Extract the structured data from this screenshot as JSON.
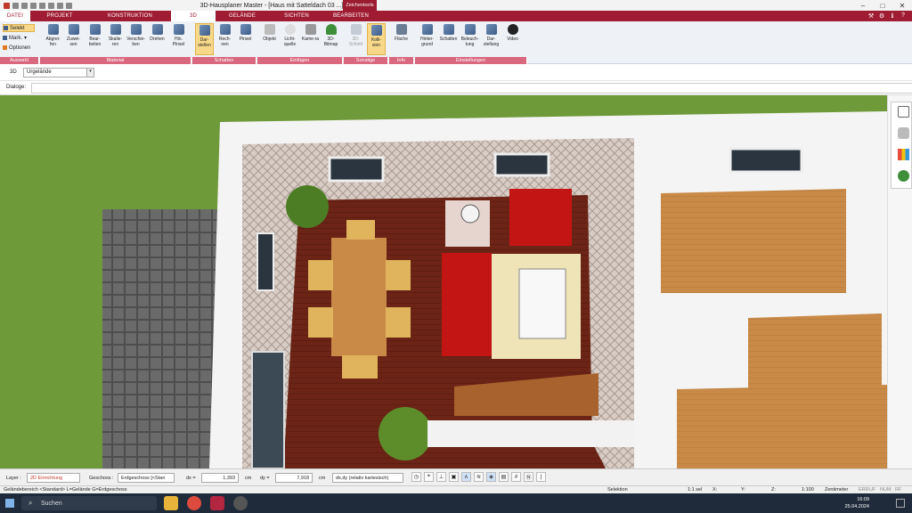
{
  "window": {
    "title": "3D-Hausplaner Master - [Haus mit Satteldach 03 ...]",
    "context_tab": "Zeichentools"
  },
  "tabs": {
    "file": "DATEI",
    "items": [
      "PROJEKT",
      "KONSTRUKTION",
      "3D",
      "GELÄNDE",
      "SICHTEN",
      "BEARBEITEN"
    ],
    "active": "3D"
  },
  "ribbon": {
    "auswahl": {
      "select": "Selekt",
      "mark": "Mark.",
      "options": "Optionen",
      "label": "Auswahl"
    },
    "material": {
      "label": "Material",
      "buttons": [
        "Abgrei-fen",
        "Zuwei-sen",
        "Bear-beiten",
        "Skalie-ren",
        "Verschie-ben",
        "Drehen",
        "Hin. Pinsel"
      ]
    },
    "schatten": {
      "label": "Schatten",
      "buttons": [
        "Dar-stellen",
        "Rech-nen",
        "Pinsel"
      ]
    },
    "einfuegen": {
      "label": "Einfügen",
      "buttons": [
        "Objekt",
        "Licht-quelle",
        "Kame-ra",
        "3D-Bitmap"
      ]
    },
    "sonstige": {
      "label": "Sonstige",
      "buttons": [
        "3D-Schnitt",
        "Kolli-sion"
      ]
    },
    "info": {
      "label": "Info",
      "buttons": [
        "Fläche"
      ]
    },
    "einstellungen": {
      "label": "Einstellungen",
      "buttons": [
        "Hinter-grund",
        "Schatten",
        "Beleuch-tung",
        "Dar-stellung",
        "Video"
      ]
    }
  },
  "optbar": {
    "mode": "3D",
    "combo_value": "Urgelände"
  },
  "dialog": {
    "label": "Dialoge:"
  },
  "statusbar": {
    "layer_label": "Layer :",
    "layer_value": "2D Einrichtung",
    "geschoss_label": "Geschoss :",
    "geschoss_value": "Erdgeschoss [<Stan",
    "dx_label": "dx =",
    "dx_value": "1,393",
    "dx_unit": "cm",
    "dy_label": "dy =",
    "dy_value": "7,918",
    "dy_unit": "cm",
    "coord_mode": "dx,dy (relativ kartesisch)"
  },
  "infobar": {
    "left": "Geländebereich <Standard> L=Gelände G=Erdgeschoss",
    "mode": "Selektion",
    "scale_sel": "1:1 sel",
    "x": "X:",
    "y": "Y:",
    "z": "Z:",
    "scale": "1:100",
    "unit": "Zentimeter",
    "flags": [
      "ERR",
      "UF",
      "NUM",
      "RF"
    ]
  },
  "taskbar": {
    "search": "Suchen",
    "time": "16:09",
    "date": "25.04.2024"
  },
  "colors": {
    "tab_bar": "#a01c33",
    "group_label": "#d9677d",
    "highlight": "#f8d98a",
    "grass": "#6f9a3a",
    "floor_wood": "#6b2416",
    "sofa_red": "#c41515"
  }
}
